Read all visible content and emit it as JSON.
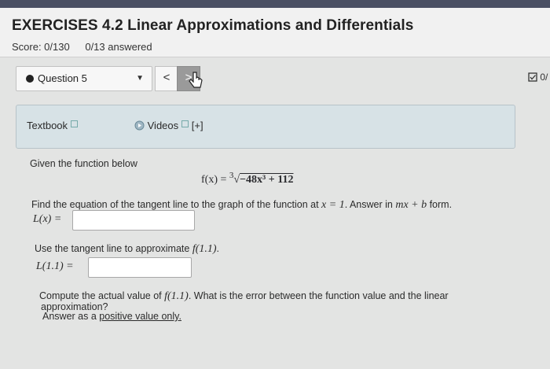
{
  "header": {
    "title": "EXERCISES 4.2 Linear Approximations and Differentials",
    "score": "Score: 0/130",
    "answered": "0/13 answered"
  },
  "nav": {
    "question_label": "Question 5",
    "prev_label": "<",
    "next_label": ">",
    "progress_label": "0/"
  },
  "resources": {
    "textbook": "Textbook",
    "videos": "Videos",
    "videos_more": "[+]"
  },
  "question": {
    "intro": "Given the function below",
    "formula_lhs": "f(x) = ",
    "formula_radicand": "−48x³ + 112",
    "part1_text": "Find the equation of the tangent line to the graph of the function at ",
    "part1_point": "x = 1",
    "part1_tail": ". Answer in ",
    "part1_form": "mx + b",
    "part1_end": " form.",
    "part1_label": "L(x) =",
    "part1_value": "",
    "part2_text": "Use the tangent line to approximate ",
    "part2_expr": "f(1.1)",
    "part2_end": ".",
    "part2_label": "L(1.1) =",
    "part2_value": "",
    "part3_line1_a": "Compute the actual value of ",
    "part3_expr": "f(1.1)",
    "part3_line1_b": ". What is the error between the function value and the linear",
    "part3_line2": "approximation?",
    "part3_line3_a": "Answer as a ",
    "part3_line3_link": "positive value only."
  },
  "icons": {
    "dot": "circle-icon",
    "ext": "external-link-icon",
    "video": "video-icon",
    "check": "checkbox-icon"
  }
}
